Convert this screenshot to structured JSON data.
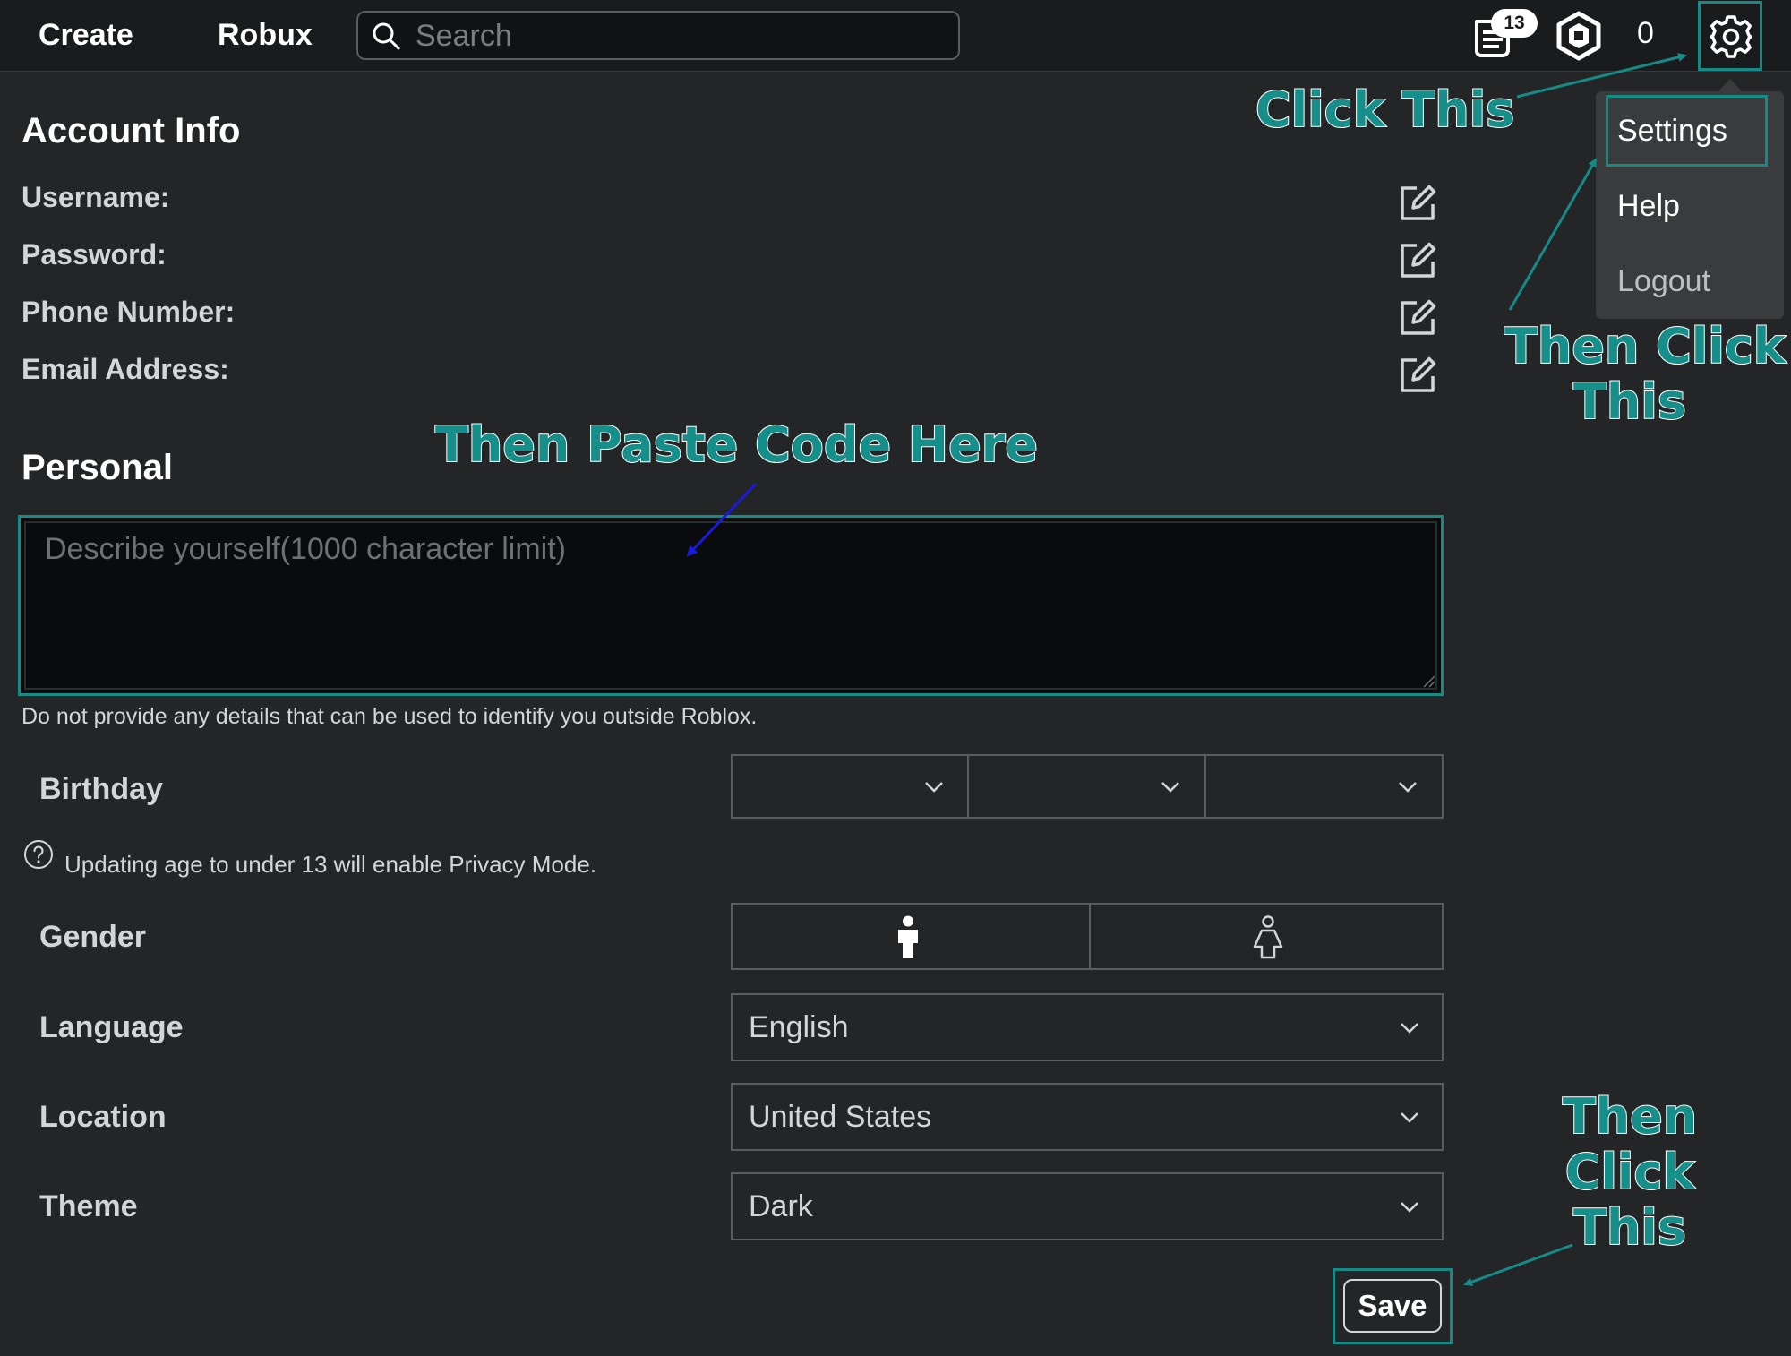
{
  "topbar": {
    "create_label": "Create",
    "robux_label": "Robux",
    "search_placeholder": "Search",
    "notification_count": "13",
    "robux_count": "0"
  },
  "menu": {
    "settings": "Settings",
    "help": "Help",
    "logout": "Logout"
  },
  "account_info": {
    "title": "Account Info",
    "fields": [
      {
        "label": "Username:"
      },
      {
        "label": "Password:"
      },
      {
        "label": "Phone Number:"
      },
      {
        "label": "Email Address:"
      }
    ]
  },
  "personal": {
    "title": "Personal",
    "description_placeholder": "Describe yourself(1000 character limit)",
    "description_value": "",
    "note": "Do not provide any details that can be used to identify you outside Roblox."
  },
  "form": {
    "birthday_label": "Birthday",
    "birthday_values": [
      "",
      "",
      ""
    ],
    "privacy_help": "Updating age to under 13 will enable Privacy Mode.",
    "gender_label": "Gender",
    "gender_options": [
      "male-icon",
      "female-icon"
    ],
    "language_label": "Language",
    "language_value": "English",
    "location_label": "Location",
    "location_value": "United States",
    "theme_label": "Theme",
    "theme_value": "Dark",
    "save_label": "Save"
  },
  "annotations": {
    "click_this": "Click This",
    "then_click_this_menu_line1": "Then Click",
    "then_click_this_menu_line2": "This",
    "paste_code": "Then Paste Code Here",
    "then_click_this_save_line1": "Then",
    "then_click_this_save_line2": "Click",
    "then_click_this_save_line3": "This"
  },
  "colors": {
    "background": "#232527",
    "topbar": "#191b1d",
    "highlight_teal": "#148b86",
    "annotation_arrow_blue": "#1a1adb"
  }
}
